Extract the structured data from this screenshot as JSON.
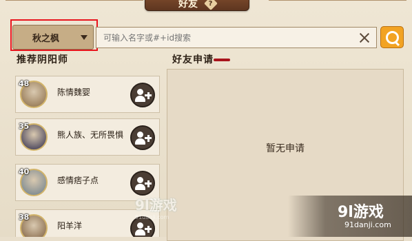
{
  "header": {
    "title": "好友",
    "help_icon": "help-diamond-icon"
  },
  "search": {
    "server_label": "秋之枫",
    "placeholder": "可输入名字或#+id搜索"
  },
  "sections": {
    "recommend_title": "推荐阴阳师",
    "requests_title": "好友申请"
  },
  "recommend": [
    {
      "level": "48",
      "name": "陈情魏婴",
      "avatar_color": "#8a6b45"
    },
    {
      "level": "35",
      "name": "熊人族、无所畏惧",
      "avatar_color": "#2d2a4a"
    },
    {
      "level": "40",
      "name": "感情痞子点",
      "avatar_color": "#6b7d8a"
    },
    {
      "level": "38",
      "name": "阳羊洋",
      "avatar_color": "#7a5a3a"
    }
  ],
  "requests": {
    "empty_text": "暂无申请"
  },
  "watermarks": {
    "center_big": "9l游戏",
    "center_small": "91danji.com",
    "corner_big": "9l游戏",
    "corner_small": "91danji.com"
  },
  "colors": {
    "accent": "#f2a323",
    "highlight_box": "#e8141c"
  }
}
